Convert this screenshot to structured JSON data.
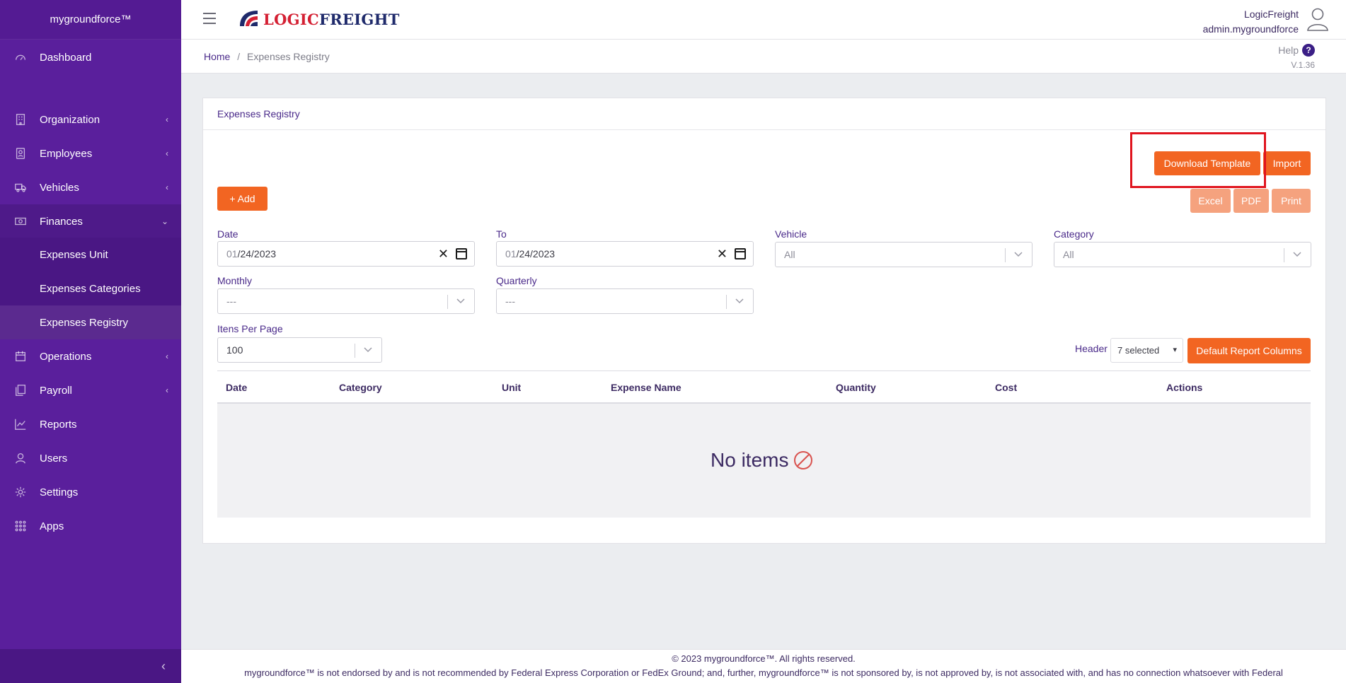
{
  "app": {
    "brand": "mygroundforce™"
  },
  "sidebar": {
    "items": [
      {
        "label": "Dashboard",
        "icon": "gauge-icon"
      },
      {
        "label": "Organization",
        "icon": "building-icon"
      },
      {
        "label": "Employees",
        "icon": "id-badge-icon"
      },
      {
        "label": "Vehicles",
        "icon": "truck-icon"
      },
      {
        "label": "Finances",
        "icon": "money-icon"
      },
      {
        "label": "Operations",
        "icon": "calendar-icon"
      },
      {
        "label": "Payroll",
        "icon": "copy-icon"
      },
      {
        "label": "Reports",
        "icon": "chart-line-icon"
      },
      {
        "label": "Users",
        "icon": "user-icon"
      },
      {
        "label": "Settings",
        "icon": "gear-icon"
      },
      {
        "label": "Apps",
        "icon": "grid-icon"
      }
    ],
    "finances_sub": [
      {
        "label": "Expenses Unit"
      },
      {
        "label": "Expenses Categories"
      },
      {
        "label": "Expenses Registry"
      }
    ]
  },
  "header": {
    "logo_part1": "LOGIC",
    "logo_part2": "FREIGHT",
    "company": "LogicFreight",
    "username": "admin.mygroundforce"
  },
  "breadcrumb": {
    "home": "Home",
    "separator": "/",
    "current": "Expenses Registry"
  },
  "help": {
    "label": "Help",
    "icon_text": "?",
    "version": "V.1.36"
  },
  "card": {
    "title": "Expenses Registry",
    "buttons": {
      "download_template": "Download Template",
      "import": "Import",
      "add": "+ Add",
      "excel": "Excel",
      "pdf": "PDF",
      "print": "Print",
      "default_report_columns": "Default Report Columns"
    },
    "filters": {
      "date_label": "Date",
      "date_month": "01",
      "date_rest": "/24/2023",
      "to_label": "To",
      "to_month": "01",
      "to_rest": "/24/2023",
      "vehicle_label": "Vehicle",
      "vehicle_value": "All",
      "category_label": "Category",
      "category_value": "All",
      "monthly_label": "Monthly",
      "monthly_value": "---",
      "quarterly_label": "Quarterly",
      "quarterly_value": "---",
      "items_per_page_label": "Itens Per Page",
      "items_per_page_value": "100"
    },
    "header_select": {
      "label": "Header",
      "value": "7 selected"
    },
    "table": {
      "columns": [
        "Date",
        "Category",
        "Unit",
        "Expense Name",
        "Quantity",
        "Cost",
        "Actions"
      ],
      "empty_message": "No items"
    }
  },
  "footer": {
    "copyright": "© 2023 mygroundforce™. All rights reserved.",
    "disclaimer": "mygroundforce™ is not endorsed by and is not recommended by Federal Express Corporation or FedEx Ground; and, further, mygroundforce™ is not sponsored by, is not approved by, is not associated with, and has no connection whatsoever with Federal"
  },
  "colors": {
    "sidebar": "#5a1f9c",
    "accent": "#f26522",
    "highlight": "#e0141e"
  }
}
